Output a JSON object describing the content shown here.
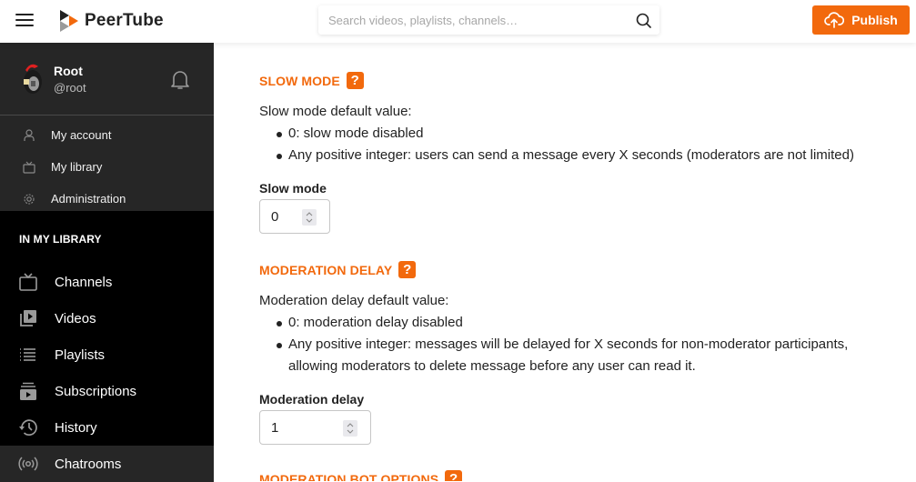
{
  "header": {
    "app_name": "PeerTube",
    "search_placeholder": "Search videos, playlists, channels…",
    "publish_label": "Publish"
  },
  "colors": {
    "accent": "#f2690d",
    "sidebar_bg": "#000000",
    "sidebar_user_bg": "#262626"
  },
  "user": {
    "name": "Root",
    "handle": "@root"
  },
  "user_menu": [
    {
      "label": "My account",
      "icon": "user-icon"
    },
    {
      "label": "My library",
      "icon": "tv-icon"
    },
    {
      "label": "Administration",
      "icon": "gear-icon"
    }
  ],
  "library": {
    "title": "IN MY LIBRARY",
    "items": [
      {
        "label": "Channels",
        "icon": "tv-icon"
      },
      {
        "label": "Videos",
        "icon": "videos-icon"
      },
      {
        "label": "Playlists",
        "icon": "list-icon"
      },
      {
        "label": "Subscriptions",
        "icon": "subscriptions-icon"
      },
      {
        "label": "History",
        "icon": "history-icon"
      },
      {
        "label": "Chatrooms",
        "icon": "broadcast-icon",
        "active": true
      }
    ]
  },
  "main": {
    "slow_mode": {
      "title": "SLOW MODE",
      "help": "?",
      "intro": "Slow mode default value:",
      "bullets": [
        "0: slow mode disabled",
        "Any positive integer: users can send a message every X seconds (moderators are not limited)"
      ],
      "field_label": "Slow mode",
      "value": "0"
    },
    "moderation_delay": {
      "title": "MODERATION DELAY",
      "help": "?",
      "intro": "Moderation delay default value:",
      "bullets": [
        "0: moderation delay disabled",
        "Any positive integer: messages will be delayed for X seconds for non-moderator participants, allowing moderators to delete message before any user can read it."
      ],
      "field_label": "Moderation delay",
      "value": "1"
    },
    "moderation_bot": {
      "title": "MODERATION BOT OPTIONS",
      "help": "?"
    }
  }
}
